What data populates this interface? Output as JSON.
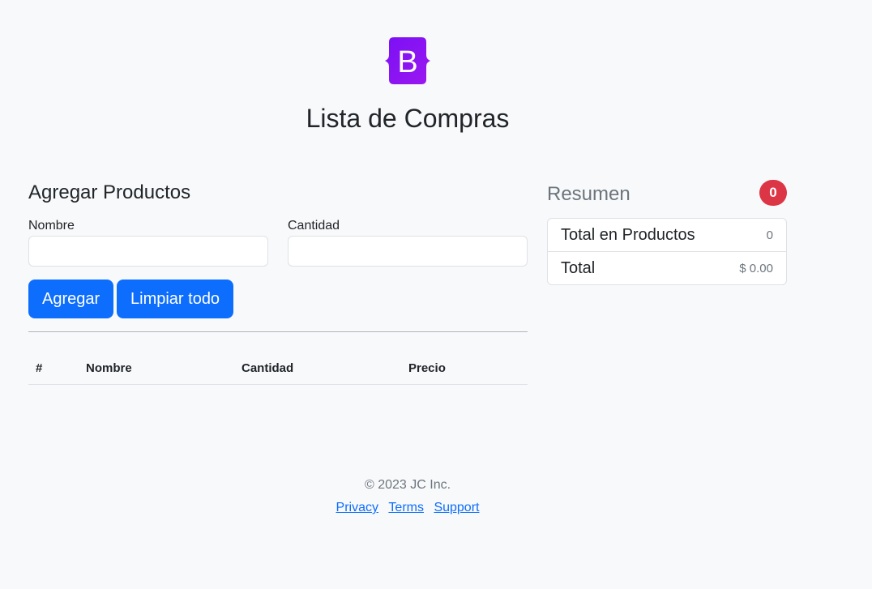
{
  "brand": {
    "logo_letter": "B",
    "logo_gradient": [
      "#7a10f5",
      "#9b18f0"
    ]
  },
  "page": {
    "title": "Lista de Compras"
  },
  "form": {
    "title": "Agregar Productos",
    "name_label": "Nombre",
    "name_value": "",
    "quantity_label": "Cantidad",
    "quantity_value": "",
    "add_button": "Agregar",
    "clear_button": "Limpiar todo"
  },
  "table": {
    "columns": [
      "#",
      "Nombre",
      "Cantidad",
      "Precio"
    ],
    "rows": []
  },
  "summary": {
    "title": "Resumen",
    "badge_count": "0",
    "rows": [
      {
        "label": "Total en Productos",
        "value": "0"
      },
      {
        "label": "Total",
        "value": "$ 0.00"
      }
    ]
  },
  "footer": {
    "copyright": "© 2023 JC Inc.",
    "links": [
      "Privacy",
      "Terms",
      "Support"
    ]
  },
  "colors": {
    "primary": "#0d6efd",
    "danger": "#dc3545",
    "muted": "#6c757d",
    "background": "#f8f9fa"
  }
}
